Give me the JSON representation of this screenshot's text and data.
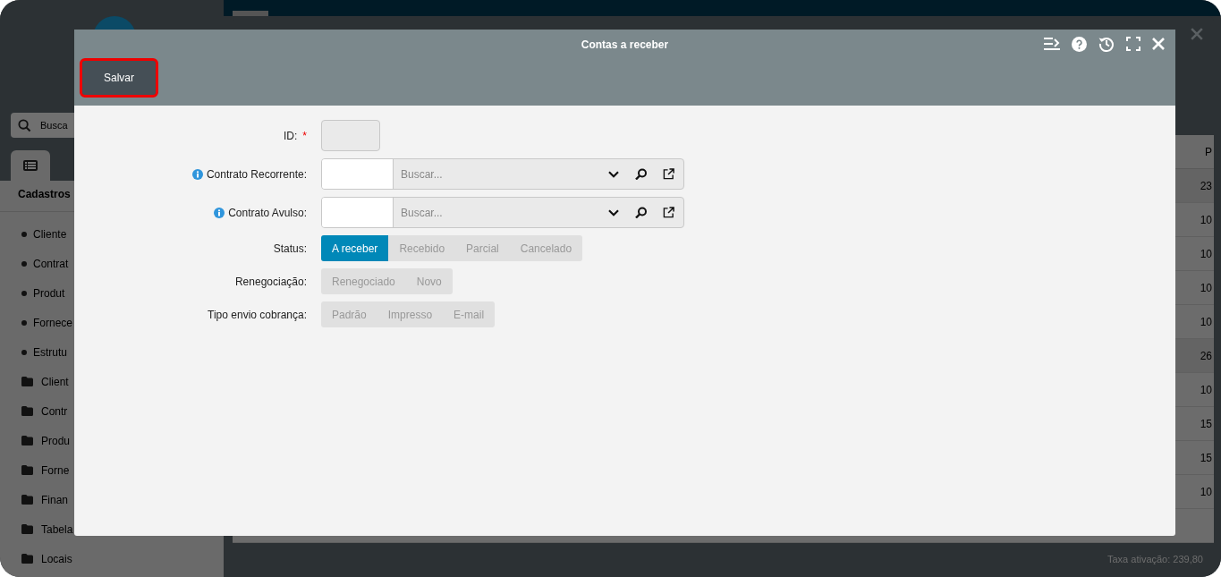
{
  "background_app": {
    "sidebar": {
      "search": {
        "placeholder": "Busca"
      },
      "section_title": "Cadastros",
      "items": [
        {
          "kind": "bullet",
          "label": "Cliente"
        },
        {
          "kind": "bullet",
          "label": "Contrat"
        },
        {
          "kind": "bullet",
          "label": "Produt"
        },
        {
          "kind": "bullet",
          "label": "Fornece"
        },
        {
          "kind": "bullet",
          "label": "Estrutu"
        },
        {
          "kind": "folder",
          "label": "Client"
        },
        {
          "kind": "folder",
          "label": "Contr"
        },
        {
          "kind": "folder",
          "label": "Produ"
        },
        {
          "kind": "folder",
          "label": "Forne"
        },
        {
          "kind": "folder",
          "label": "Finan"
        },
        {
          "kind": "folder",
          "label": "Tabela"
        },
        {
          "kind": "folder",
          "label": "Locais"
        }
      ]
    },
    "table": {
      "column_1": "P",
      "rows": [
        "23",
        "10",
        "10",
        "10",
        "10",
        "26",
        "10",
        "15",
        "15",
        "10"
      ]
    },
    "footer": "Taxa ativação: 239,80"
  },
  "dialog": {
    "title": "Contas a receber",
    "toolbar": [
      {
        "label": "Salvar",
        "highlighted": true
      }
    ],
    "fields": [
      {
        "kind": "text",
        "label": "ID:",
        "required_mark": "*",
        "info": false
      },
      {
        "kind": "lookup",
        "label": "Contrato Recorrente:",
        "info": true,
        "placeholder": "Buscar..."
      },
      {
        "kind": "lookup",
        "label": "Contrato Avulso:",
        "info": true,
        "placeholder": "Buscar..."
      },
      {
        "kind": "segmented",
        "label": "Status:",
        "info": false,
        "options": [
          {
            "label": "A receber",
            "selected": true
          },
          {
            "label": "Recebido",
            "selected": false
          },
          {
            "label": "Parcial",
            "selected": false
          },
          {
            "label": "Cancelado",
            "selected": false
          }
        ]
      },
      {
        "kind": "segmented",
        "label": "Renegociação:",
        "info": false,
        "options": [
          {
            "label": "Renegociado",
            "selected": false
          },
          {
            "label": "Novo",
            "selected": false
          }
        ]
      },
      {
        "kind": "segmented",
        "label": "Tipo envio cobrança:",
        "info": false,
        "options": [
          {
            "label": "Padrão",
            "selected": false
          },
          {
            "label": "Impresso",
            "selected": false
          },
          {
            "label": "E-mail",
            "selected": false
          }
        ]
      }
    ]
  }
}
